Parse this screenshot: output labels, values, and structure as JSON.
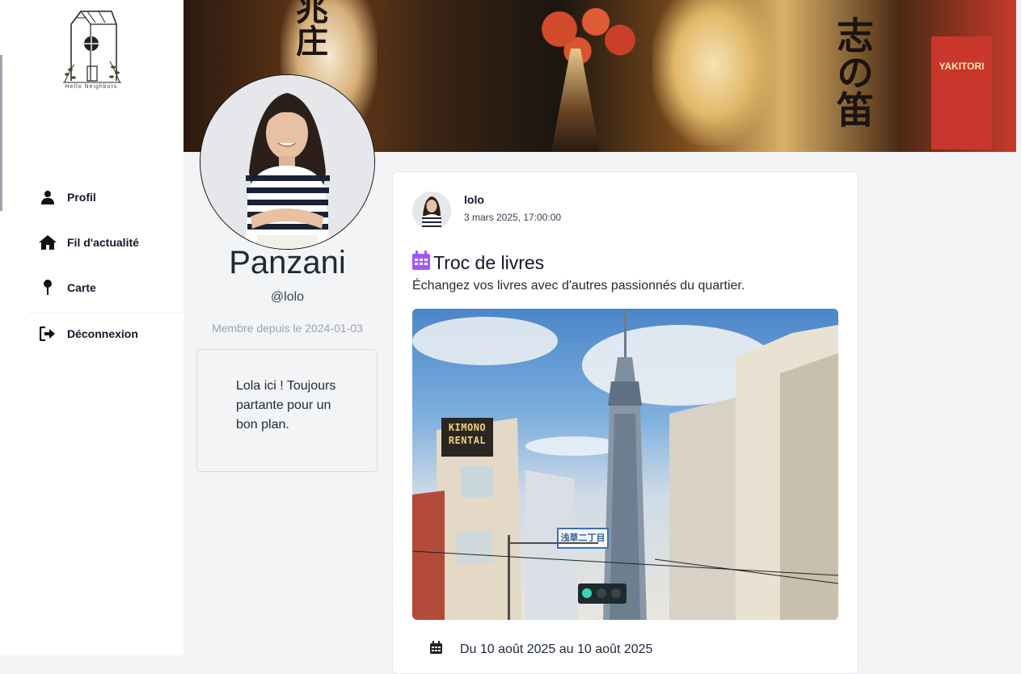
{
  "app": {
    "logo_text": "Hello Neighbors"
  },
  "sidebar": {
    "items": [
      {
        "label": "Profil",
        "icon": "user-icon"
      },
      {
        "label": "Fil d'actualité",
        "icon": "home-icon"
      },
      {
        "label": "Carte",
        "icon": "pin-icon"
      },
      {
        "label": "Déconnexion",
        "icon": "logout-icon"
      }
    ]
  },
  "banner": {
    "kanji_main": "志の笛",
    "kanji_left": "兆庄",
    "sign": "YAKITORI"
  },
  "profile": {
    "name": "Panzani",
    "handle": "@lolo",
    "member_since": "Membre depuis le 2024-01-03",
    "bio": "Lola ici ! Toujours partante pour un bon plan."
  },
  "post": {
    "author": "lolo",
    "date": "3 mars 2025, 17:00:00",
    "title": "Troc de livres",
    "description": "Échangez vos livres avec d'autres passionnés du quartier.",
    "event_dates": "Du 10 août 2025 au 10 août 2025",
    "image_sign_top": "KIMONO",
    "image_sign_bottom": "RENTAL",
    "image_street_sign": "浅草二丁目"
  },
  "colors": {
    "accent_purple": "#a855f7",
    "text_dark": "#111827",
    "muted": "#9ca3af",
    "page_bg": "#f3f4f6"
  }
}
